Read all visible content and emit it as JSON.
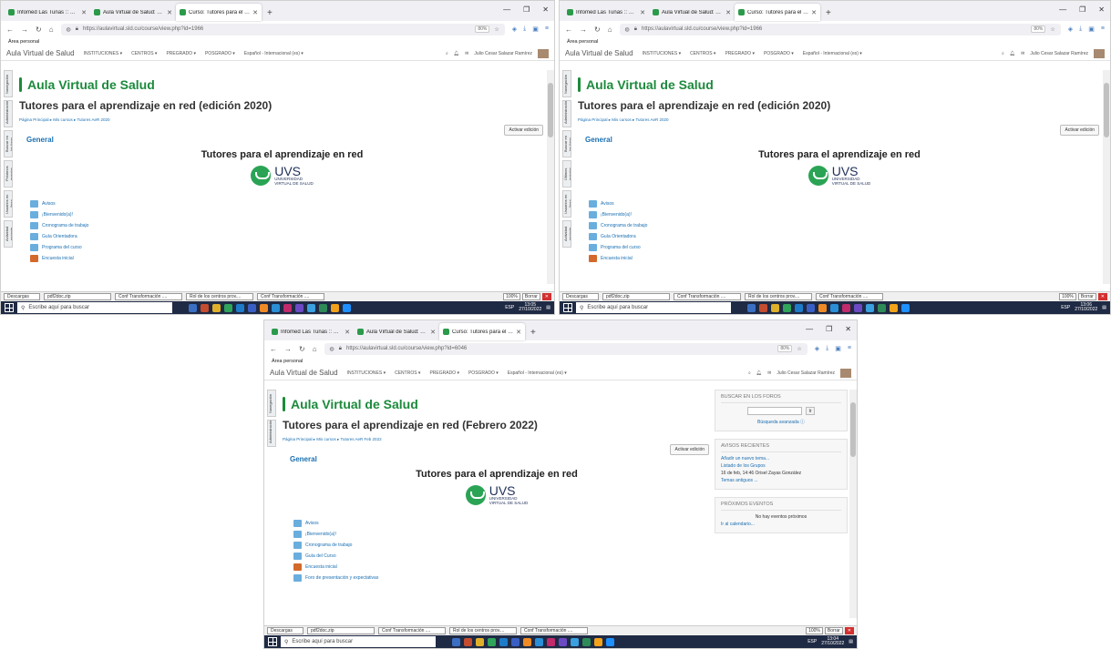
{
  "screenshots": [
    {
      "tabs": [
        {
          "label": "Infomed Las Tunas :: Entrada",
          "active": false
        },
        {
          "label": "Aula Virtual de Salud: Autoaprendizaje",
          "active": false
        },
        {
          "label": "Curso: Tutores para el aprendizaje en red",
          "active": true
        }
      ],
      "url": "https://aulavirtual.sld.cu/course/view.php?id=1966",
      "zoom": "80%",
      "bookmark": "Área personal",
      "brand": "Aula Virtual de Salud",
      "menu": [
        "INSTITUCIONES ▾",
        "CENTROS ▾",
        "PREGRADO ▾",
        "POSGRADO ▾",
        "Español - Internacional (es) ▾"
      ],
      "user": "Julio Cesar Salazar Ramírez",
      "dock": [
        "Navegación",
        "Administración",
        "Buscar en los foros",
        "Próximos eventos",
        "Usuarios en línea",
        "Actividad reciente"
      ],
      "site_title": "Aula Virtual de Salud",
      "course_title": "Tutores para el aprendizaje en red (edición 2020)",
      "breadcrumb": "Página Principal ▸ Mis cursos ▸ Tutores AeR 2020",
      "edit_button": "Activar edición",
      "general": "General",
      "section_heading": "Tutores para el aprendizaje en red",
      "logo_main": "UVS",
      "logo_sub1": "UNIVERSIDAD",
      "logo_sub2": "VIRTUAL DE SALUD",
      "activities": [
        "Avisos",
        "¡Bienvenido(a)!",
        "Cronograma de trabajo",
        "Guía Orientadora",
        "Programa del curso",
        "Encuesta inicial"
      ],
      "downloads_label": "Descargas",
      "downloads": [
        "pdf2doc.zip",
        "Conf Transformación ....",
        "Rol de los centros prov....",
        "Conf Transformación ...."
      ],
      "dl_zoom": "100%",
      "dl_clear": "Borrar",
      "search_placeholder": "Escribe aquí para buscar",
      "lang": "ESP",
      "time": "13:05",
      "date": "27/10/2022"
    },
    {
      "tabs": [
        {
          "label": "Infomed Las Tunas :: Entrada",
          "active": false
        },
        {
          "label": "Aula Virtual de Salud: Autoaprendizaje",
          "active": false
        },
        {
          "label": "Curso: Tutores para el aprendizaje en red",
          "active": true
        }
      ],
      "url": "https://aulavirtual.sld.cu/course/view.php?id=1966",
      "zoom": "80%",
      "bookmark": "Área personal",
      "brand": "Aula Virtual de Salud",
      "menu": [
        "INSTITUCIONES ▾",
        "CENTROS ▾",
        "PREGRADO ▾",
        "POSGRADO ▾",
        "Español - Internacional (es) ▾"
      ],
      "user": "Julio Cesar Salazar Ramírez",
      "dock": [
        "Navegación",
        "Administración",
        "Buscar en los foros",
        "Últimos eventos",
        "Usuarios en línea",
        "Actividad reciente"
      ],
      "site_title": "Aula Virtual de Salud",
      "course_title": "Tutores para el aprendizaje en red (edición 2020)",
      "breadcrumb": "Página Principal ▸ Mis cursos ▸ Tutores AeR 2020",
      "edit_button": "Activar edición",
      "general": "General",
      "section_heading": "Tutores para el aprendizaje en red",
      "logo_main": "UVS",
      "logo_sub1": "UNIVERSIDAD",
      "logo_sub2": "VIRTUAL DE SALUD",
      "activities": [
        "Avisos",
        "¡Bienvenido(a)!",
        "Cronograma de trabajo",
        "Guía Orientadora",
        "Programa del curso",
        "Encuesta inicial"
      ],
      "downloads_label": "Descargas",
      "downloads": [
        "pdf2doc.zip",
        "Conf Transformación ....",
        "Rol de los centros prov....",
        "Conf Transformación ...."
      ],
      "dl_zoom": "100%",
      "dl_clear": "Borrar",
      "search_placeholder": "Escribe aquí para buscar",
      "lang": "ESP",
      "time": "13:06",
      "date": "27/10/2022"
    },
    {
      "tabs": [
        {
          "label": "Infomed Las Tunas :: Entrada",
          "active": false
        },
        {
          "label": "Aula Virtual de Salud: Autoaprendizaje",
          "active": false
        },
        {
          "label": "Curso: Tutores para el aprendizaje en red",
          "active": true
        }
      ],
      "url": "https://aulavirtual.sld.cu/course/view.php?id=6046",
      "zoom": "80%",
      "bookmark": "Área personal",
      "brand": "Aula Virtual de Salud",
      "menu": [
        "INSTITUCIONES ▾",
        "CENTROS ▾",
        "PREGRADO ▾",
        "POSGRADO ▾",
        "Español - Internacional (es) ▾"
      ],
      "user": "Julio Cesar Salazar Ramírez",
      "dock": [
        "Navegación",
        "Administración"
      ],
      "site_title": "Aula Virtual de Salud",
      "course_title": "Tutores para el aprendizaje en red (Febrero 2022)",
      "breadcrumb": "Página Principal ▸ Mis cursos ▸ Tutores AeR Feb 2022",
      "edit_button": "Activar edición",
      "general": "General",
      "section_heading": "Tutores para el aprendizaje en red",
      "logo_main": "UVS",
      "logo_sub1": "UNIVERSIDAD",
      "logo_sub2": "VIRTUAL DE SALUD",
      "activities": [
        "Avisos",
        "¡Bienvenido(a)!",
        "Cronograma de trabajo",
        "Guía del Curso",
        "Encuesta inicial",
        "Foro de presentación y expectativas"
      ],
      "blocks": {
        "search_title": "BUSCAR EN LOS FOROS",
        "search_go": "Ir",
        "advanced_search": "Búsqueda avanzada ⓘ",
        "news_title": "AVISOS RECIENTES",
        "add_topic": "Añadir un nuevo tema...",
        "news_item": "Listado de los Grupos",
        "news_meta": "16 de feb, 14:46 Orisel Zayas González",
        "old_topics": "Temas antiguos ...",
        "events_title": "PRÓXIMOS EVENTOS",
        "no_events": "No hay eventos próximos",
        "calendar_link": "Ir al calendario..."
      },
      "downloads_label": "Descargas",
      "downloads": [
        "pdf2doc.zip",
        "Conf Transformación ....",
        "Rol de los centros prov....",
        "Conf Transformación ...."
      ],
      "dl_zoom": "100%",
      "dl_clear": "Borrar",
      "search_placeholder": "Escribe aquí para buscar",
      "lang": "ESP",
      "time": "13:04",
      "date": "27/10/2022"
    }
  ],
  "colors": {
    "accent_green": "#1c8a3c",
    "link_blue": "#1a6fb2",
    "taskbar": "#1f2a44",
    "logo_navy": "#1f2f5a"
  }
}
